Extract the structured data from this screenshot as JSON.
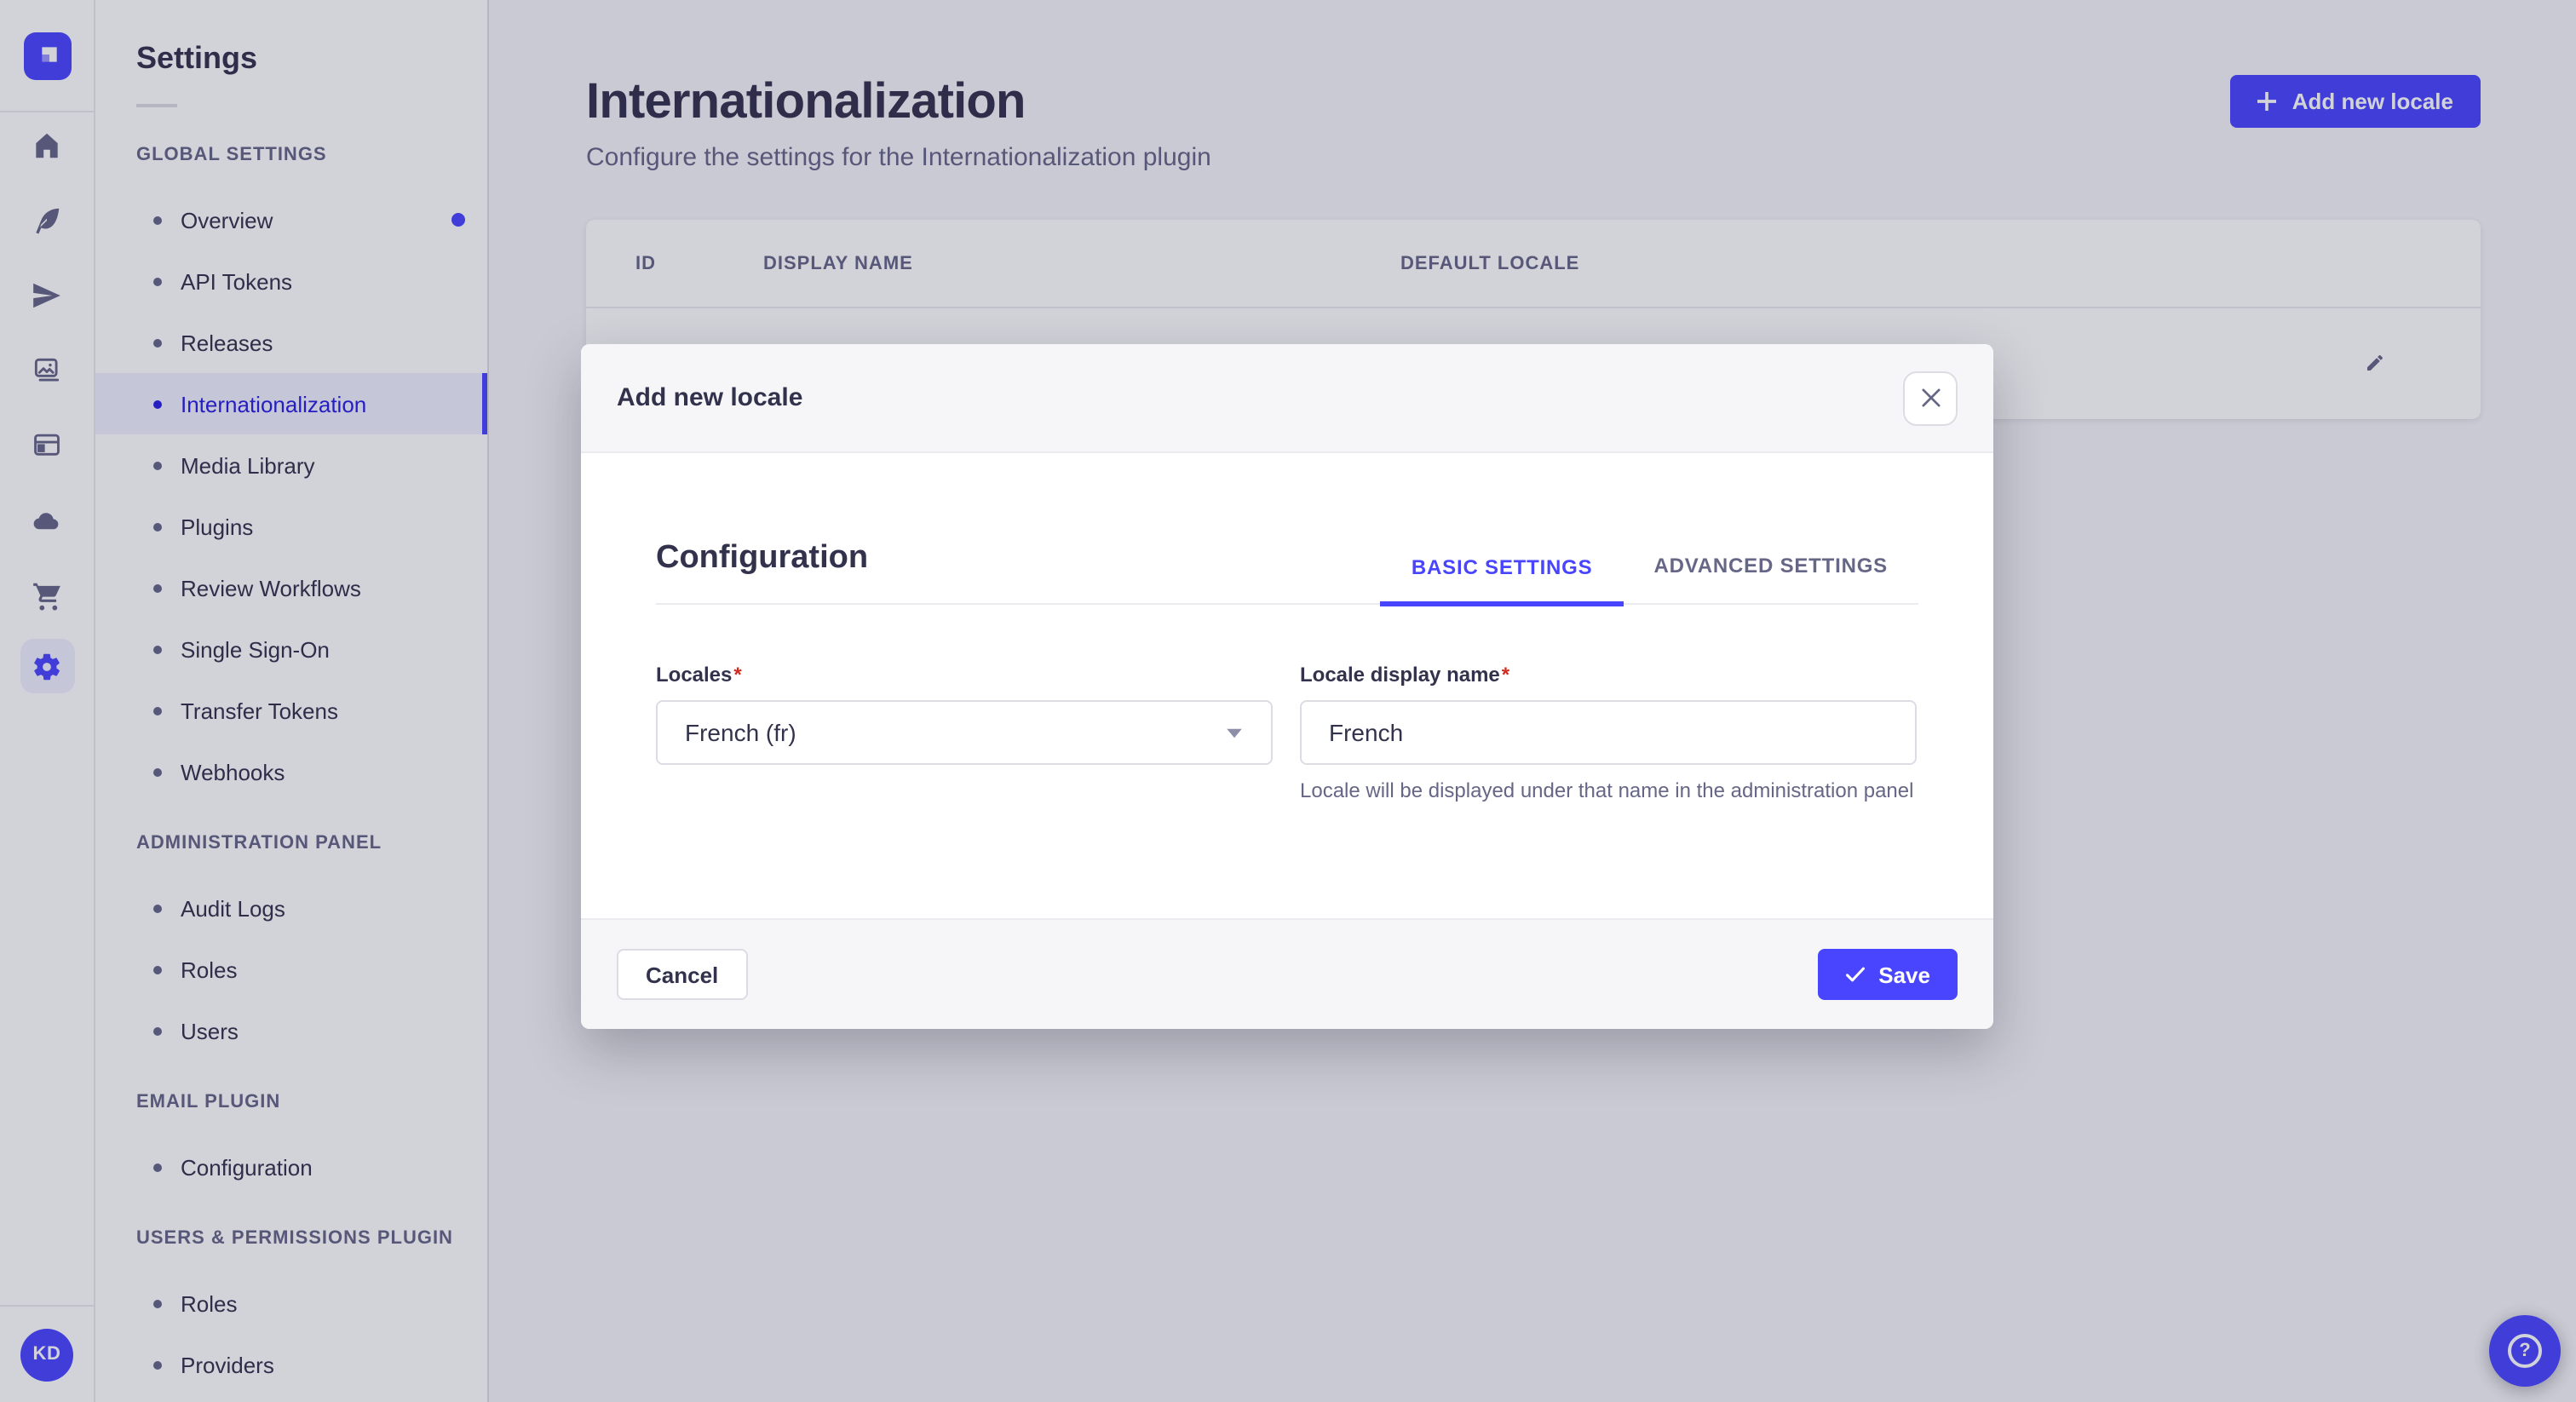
{
  "sidebar": {
    "title": "Settings",
    "sections": [
      {
        "label": "GLOBAL SETTINGS",
        "items": [
          {
            "label": "Overview",
            "notification": true
          },
          {
            "label": "API Tokens"
          },
          {
            "label": "Releases"
          },
          {
            "label": "Internationalization",
            "active": true
          },
          {
            "label": "Media Library"
          },
          {
            "label": "Plugins"
          },
          {
            "label": "Review Workflows"
          },
          {
            "label": "Single Sign-On"
          },
          {
            "label": "Transfer Tokens"
          },
          {
            "label": "Webhooks"
          }
        ]
      },
      {
        "label": "ADMINISTRATION PANEL",
        "items": [
          {
            "label": "Audit Logs"
          },
          {
            "label": "Roles"
          },
          {
            "label": "Users"
          }
        ]
      },
      {
        "label": "EMAIL PLUGIN",
        "items": [
          {
            "label": "Configuration"
          }
        ]
      },
      {
        "label": "USERS & PERMISSIONS PLUGIN",
        "items": [
          {
            "label": "Roles"
          },
          {
            "label": "Providers"
          }
        ]
      }
    ]
  },
  "rail": {
    "icons": [
      "home",
      "feather",
      "send",
      "images",
      "layout",
      "cloud",
      "cart",
      "settings-gear"
    ],
    "avatar_initials": "KD"
  },
  "header": {
    "title": "Internationalization",
    "subtitle": "Configure the settings for the Internationalization plugin",
    "add_button_label": "Add new locale"
  },
  "table": {
    "columns": [
      "ID",
      "DISPLAY NAME",
      "DEFAULT LOCALE"
    ],
    "row_action_icon": "pencil-edit"
  },
  "modal": {
    "title": "Add new locale",
    "close_icon": "x-close",
    "section_title": "Configuration",
    "tabs": [
      {
        "label": "BASIC SETTINGS",
        "active": true
      },
      {
        "label": "ADVANCED SETTINGS",
        "active": false
      }
    ],
    "fields": {
      "locales": {
        "label": "Locales",
        "required_mark": "*",
        "value": "French (fr)"
      },
      "display_name": {
        "label": "Locale display name",
        "required_mark": "*",
        "value": "French",
        "hint": "Locale will be displayed under that name in the administration panel"
      }
    },
    "cancel_label": "Cancel",
    "save_label": "Save"
  },
  "fab": {
    "label": "?"
  },
  "colors": {
    "primary": "#4945ff",
    "primary_dark": "#271fe0",
    "primary_light": "#f0f0ff",
    "text": "#32324d",
    "muted": "#666687",
    "border": "#dcdce4",
    "divider": "#eaeaef",
    "danger": "#d02b20"
  }
}
